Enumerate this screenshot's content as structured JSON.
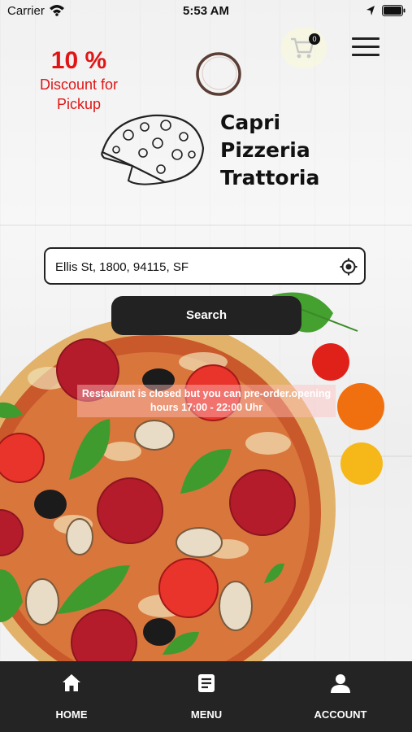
{
  "status_bar": {
    "carrier": "Carrier",
    "time": "5:53 AM"
  },
  "header": {
    "cart_count": "0"
  },
  "promo": {
    "percent": "10 %",
    "text": "Discount for Pickup"
  },
  "logo": {
    "line1": "Capri",
    "line2": "Pizzeria",
    "line3": "Trattoria"
  },
  "search": {
    "address_value": "Ellis St, 1800, 94115, SF",
    "button_label": "Search"
  },
  "notice": {
    "closed_text": "Restaurant is closed but you can pre-order.opening hours 17:00 - 22:00 Uhr"
  },
  "bottom_nav": {
    "items": [
      {
        "label": "HOME",
        "icon": "home-icon"
      },
      {
        "label": "MENU",
        "icon": "menu-list-icon"
      },
      {
        "label": "ACCOUNT",
        "icon": "account-icon"
      }
    ]
  },
  "colors": {
    "accent_red": "#e01616",
    "dark": "#222222",
    "nav_bg": "#242424"
  }
}
